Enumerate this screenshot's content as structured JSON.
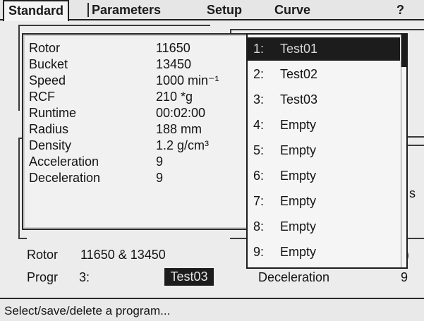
{
  "tabs": {
    "standard": "Standard",
    "parameters": "Parameters",
    "setup": "Setup",
    "curve": "Curve",
    "help": "?"
  },
  "run_data": {
    "rotor": {
      "label": "Rotor",
      "value": "11650"
    },
    "bucket": {
      "label": "Bucket",
      "value": "13450"
    },
    "speed": {
      "label": "Speed",
      "value": "1000 min⁻¹"
    },
    "rcf": {
      "label": "RCF",
      "value": "210 *g"
    },
    "runtime": {
      "label": "Runtime",
      "value": "00:02:00"
    },
    "radius": {
      "label": "Radius",
      "value": "188 mm"
    },
    "density": {
      "label": "Density",
      "value": "1.2 g/cm³"
    },
    "acceleration": {
      "label": "Acceleration",
      "value": "9"
    },
    "deceleration": {
      "label": "Deceleration",
      "value": "9"
    }
  },
  "program_list": [
    {
      "num": "1:",
      "name": "Test01"
    },
    {
      "num": "2:",
      "name": "Test02"
    },
    {
      "num": "3:",
      "name": "Test03"
    },
    {
      "num": "4:",
      "name": "Empty"
    },
    {
      "num": "5:",
      "name": "Empty"
    },
    {
      "num": "6:",
      "name": "Empty"
    },
    {
      "num": "7:",
      "name": "Empty"
    },
    {
      "num": "8:",
      "name": "Empty"
    },
    {
      "num": "9:",
      "name": "Empty"
    }
  ],
  "bottom": {
    "rotor_label": "Rotor",
    "rotor_value": "11650 & 13450",
    "progr_label": "Progr",
    "progr_num": "3:",
    "progr_name": "Test03",
    "decel_label": "Deceleration",
    "decel_value": "9",
    "partial_right_s": "s",
    "partial_right_paren": ")"
  },
  "status": {
    "message": "Select/save/delete a program..."
  },
  "colors": {
    "background": "#ececec",
    "highlight": "#1c1c1c",
    "highlight_text": "#d8d8d8"
  }
}
